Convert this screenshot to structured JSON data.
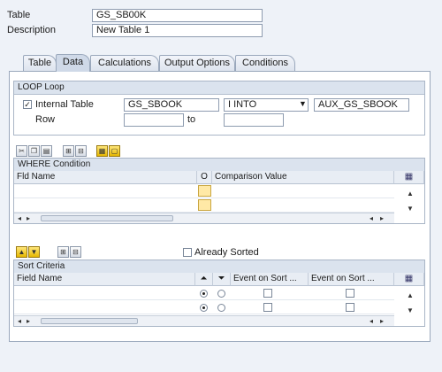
{
  "header": {
    "table_label": "Table",
    "table_value": "GS_SB00K",
    "description_label": "Description",
    "description_value": "New Table 1"
  },
  "tabs": [
    {
      "label": "Table",
      "active": false
    },
    {
      "label": "Data",
      "active": true
    },
    {
      "label": "Calculations",
      "active": false
    },
    {
      "label": "Output Options",
      "active": false
    },
    {
      "label": "Conditions",
      "active": false
    }
  ],
  "loop": {
    "title": "LOOP Loop",
    "internal_table_label": "Internal Table",
    "internal_table_checked": true,
    "internal_table_value": "GS_SBOOK",
    "mode_value": "I INTO",
    "target_value": "AUX_GS_SBOOK",
    "row_label": "Row",
    "row_from": "",
    "to_label": "to",
    "row_to": ""
  },
  "where": {
    "title": "WHERE Condition",
    "columns": [
      "Fld Name",
      "O",
      "Comparison Value"
    ]
  },
  "sort": {
    "already_sorted_label": "Already Sorted",
    "already_sorted_checked": false,
    "title": "Sort Criteria",
    "columns": [
      "Field Name",
      "Event on Sort ...",
      "Event on Sort ..."
    ],
    "rows": [
      {
        "field": "",
        "ascending": true
      },
      {
        "field": "",
        "ascending": true
      }
    ]
  },
  "icons": {
    "colors": {
      "accent": "#cfd9e8",
      "yellow": "#ffe9a6"
    }
  }
}
